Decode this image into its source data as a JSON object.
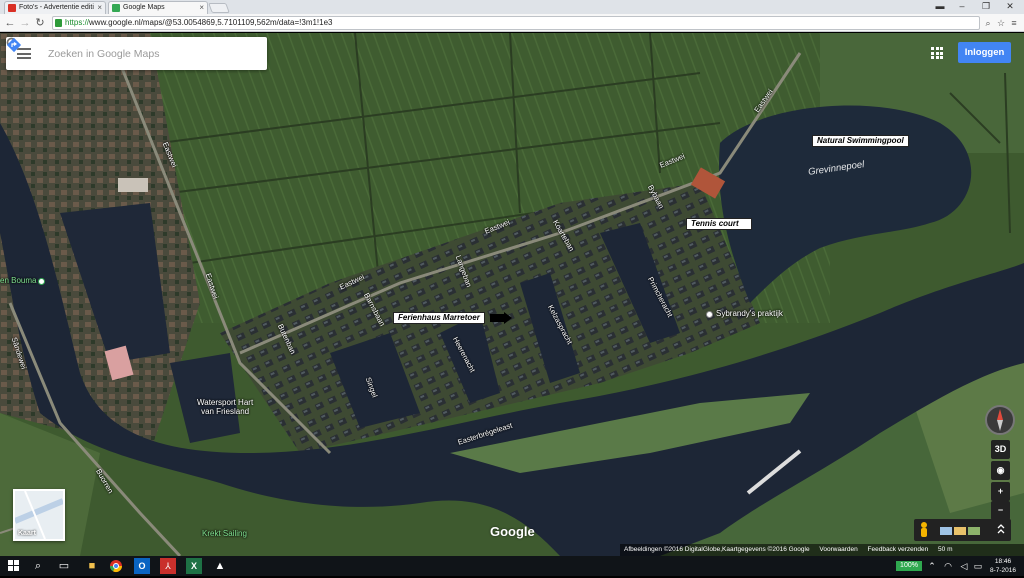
{
  "browser": {
    "tabs": [
      {
        "title": "Foto's - Advertentie editi",
        "color": "#d93025"
      },
      {
        "title": "Google Maps",
        "color": "#34a853"
      }
    ],
    "url_scheme": "https://",
    "url_rest": "www.google.nl/maps/@53.0054869,5.7101109,562m/data=!3m1!1e3",
    "window_controls": [
      "–",
      "❐",
      "✕"
    ]
  },
  "maps": {
    "search_placeholder": "Zoeken in Google Maps",
    "login_label": "Inloggen",
    "kaart_label": "Kaart",
    "google_logo": "Google",
    "btn_3d": "3D",
    "btn_zoom_in": "+",
    "btn_zoom_out": "−",
    "attribution": [
      "Afbeeldingen ©2016 DigitalGlobe,Kaartgegevens ©2016 Google",
      "Voorwaarden",
      "Feedback verzenden",
      "50 m"
    ]
  },
  "labels": {
    "eastwei_1": "Eastwei",
    "eastwei_2": "Eastwei",
    "eastwei_3": "Eastwei",
    "eastwei_4": "Eastwei",
    "eastwei_5": "Eastwei",
    "eastwei_6": "Eastwei",
    "eastwei_7": "Eastwei",
    "bybaan": "Bybaan",
    "koarteban": "Koarteban",
    "langeban": "Langeban",
    "barnsbaan": "Barnsbaan",
    "butenban": "Butenban",
    "heerenacht": "Heerenacht",
    "kelzaspracht": "Kelzaspracht",
    "primcheracht": "Primcheracht",
    "easterbregeleast": "Easterbrégeleast",
    "buorren": "Buorren",
    "sandewei": "Sândewei",
    "singel": "Singel",
    "grevinnepoel": "Grevinnepoel",
    "watersport": "Watersport Hart\nvan Friesland",
    "sybrandy": "Sybrandy's praktijk",
    "bouma": "en Bouma",
    "krekt_sailing": "Krekt Sailing",
    "natural_swimmingpool": "Natural Swimmingpool",
    "tennis_court": "Tennis court",
    "ferienhaus": "Ferienhaus Marretoer"
  },
  "taskbar": {
    "battery": "100%",
    "time": "18:46",
    "date": "8-7-2016"
  },
  "colors": {
    "water": "#1d2636",
    "field": "#3d5a2e",
    "field_light": "#4f6e39",
    "accent_blue": "#4285f4"
  }
}
